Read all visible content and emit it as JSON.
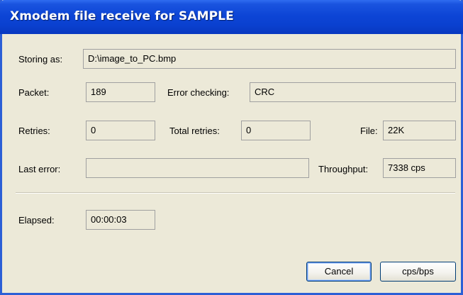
{
  "window": {
    "title": "Xmodem file receive for SAMPLE"
  },
  "storing": {
    "label": "Storing as:",
    "value": "D:\\image_to_PC.bmp"
  },
  "packet": {
    "label": "Packet:",
    "value": "189"
  },
  "error_checking": {
    "label": "Error checking:",
    "value": "CRC"
  },
  "retries": {
    "label": "Retries:",
    "value": "0"
  },
  "total_retries": {
    "label": "Total retries:",
    "value": "0"
  },
  "file": {
    "label": "File:",
    "value": "22K"
  },
  "last_error": {
    "label": "Last error:",
    "value": ""
  },
  "throughput": {
    "label": "Throughput:",
    "value": "7338 cps"
  },
  "elapsed": {
    "label": "Elapsed:",
    "value": "00:00:03"
  },
  "buttons": {
    "cancel": "Cancel",
    "cps_bps": "cps/bps"
  }
}
